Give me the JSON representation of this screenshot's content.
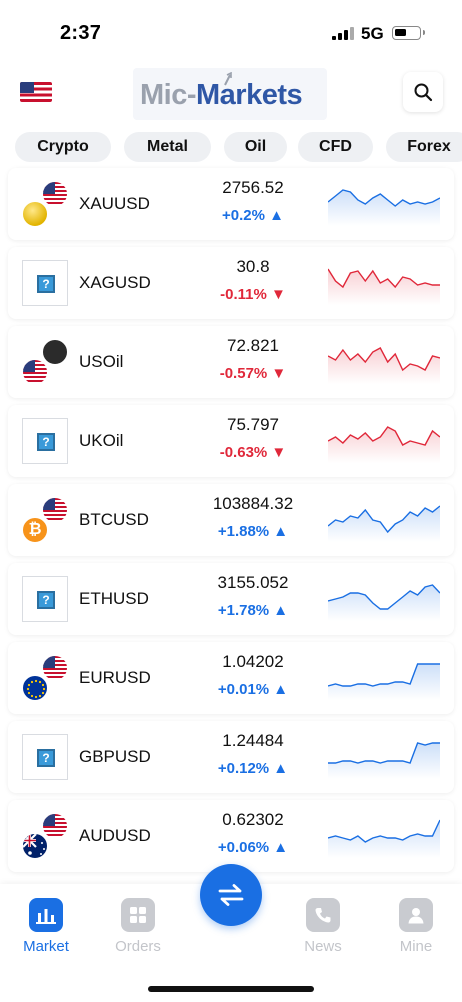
{
  "status": {
    "time": "2:37",
    "network": "5G"
  },
  "header": {
    "logo_part1": "Mic-",
    "logo_part2": "Markets",
    "search_icon": "search-icon"
  },
  "tabs": [
    "Crypto",
    "Metal",
    "Oil",
    "CFD",
    "Forex"
  ],
  "colors": {
    "up": "#1a6fe3",
    "down": "#e0283a",
    "accent": "#1a6fe3"
  },
  "instruments": [
    {
      "symbol": "XAUUSD",
      "price": "2756.52",
      "change": "+0.2%",
      "direction": "up",
      "icon": "gold-us-flag-icon",
      "spark": [
        22,
        16,
        10,
        12,
        20,
        24,
        18,
        14,
        20,
        26,
        20,
        24,
        22,
        24,
        22,
        18
      ]
    },
    {
      "symbol": "XAGUSD",
      "price": "30.8",
      "change": "-0.11%",
      "direction": "down",
      "icon": "placeholder-icon",
      "spark": [
        10,
        22,
        28,
        14,
        12,
        22,
        12,
        24,
        20,
        28,
        18,
        20,
        26,
        24,
        26,
        26
      ]
    },
    {
      "symbol": "USOil",
      "price": "72.821",
      "change": "-0.57%",
      "direction": "down",
      "icon": "oil-us-flag-icon",
      "spark": [
        18,
        22,
        12,
        22,
        16,
        24,
        14,
        10,
        24,
        16,
        32,
        26,
        28,
        32,
        18,
        20
      ]
    },
    {
      "symbol": "UKOil",
      "price": "75.797",
      "change": "-0.63%",
      "direction": "down",
      "icon": "placeholder-icon",
      "spark": [
        24,
        20,
        26,
        18,
        22,
        16,
        24,
        20,
        10,
        14,
        28,
        24,
        26,
        28,
        14,
        20
      ]
    },
    {
      "symbol": "BTCUSD",
      "price": "103884.32",
      "change": "+1.88%",
      "direction": "up",
      "icon": "bitcoin-us-flag-icon",
      "spark": [
        30,
        24,
        26,
        20,
        22,
        14,
        24,
        26,
        36,
        28,
        24,
        16,
        20,
        12,
        16,
        10
      ]
    },
    {
      "symbol": "ETHUSD",
      "price": "3155.052",
      "change": "+1.78%",
      "direction": "up",
      "icon": "placeholder-icon",
      "spark": [
        26,
        24,
        22,
        18,
        18,
        20,
        28,
        34,
        34,
        28,
        22,
        16,
        20,
        12,
        10,
        18
      ]
    },
    {
      "symbol": "EURUSD",
      "price": "1.04202",
      "change": "+0.01%",
      "direction": "up",
      "icon": "eu-us-flag-icon",
      "spark": [
        32,
        30,
        32,
        32,
        30,
        30,
        32,
        30,
        30,
        28,
        28,
        30,
        10,
        10,
        10,
        10
      ]
    },
    {
      "symbol": "GBPUSD",
      "price": "1.24484",
      "change": "+0.12%",
      "direction": "up",
      "icon": "placeholder-icon",
      "spark": [
        30,
        30,
        28,
        28,
        30,
        28,
        28,
        30,
        28,
        28,
        28,
        30,
        10,
        12,
        10,
        10
      ]
    },
    {
      "symbol": "AUDUSD",
      "price": "0.62302",
      "change": "+0.06%",
      "direction": "up",
      "icon": "au-us-flag-icon",
      "spark": [
        26,
        24,
        26,
        28,
        24,
        30,
        26,
        24,
        26,
        26,
        28,
        24,
        22,
        24,
        24,
        8
      ]
    }
  ],
  "nav": [
    {
      "label": "Market",
      "icon": "bar-chart-icon",
      "active": true
    },
    {
      "label": "Orders",
      "icon": "grid-icon",
      "active": false
    },
    {
      "label": "News",
      "icon": "phone-icon",
      "active": false
    },
    {
      "label": "Mine",
      "icon": "user-icon",
      "active": false
    }
  ],
  "fab_icon": "swap-arrows-icon"
}
